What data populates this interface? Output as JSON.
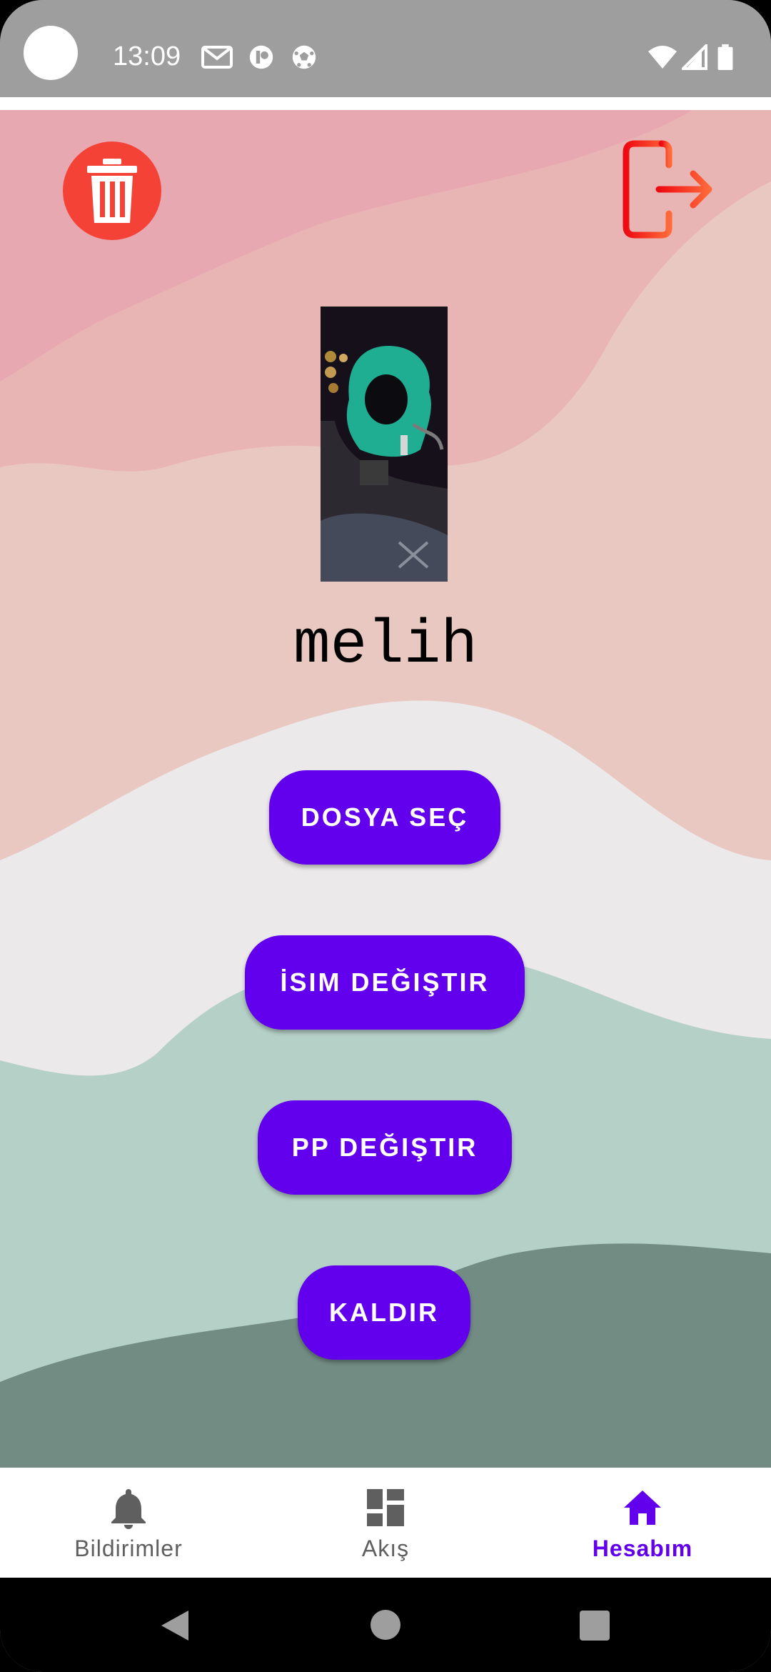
{
  "status_bar": {
    "time": "13:09",
    "left_icons": [
      "gmail-icon",
      "app-notification-icon",
      "soccer-ball-icon"
    ],
    "right_icons": [
      "wifi-icon",
      "signal-icon",
      "battery-icon"
    ]
  },
  "header": {
    "delete_account_icon": "trash-icon",
    "delete_color": "#f44336",
    "logout_icon": "logout-icon",
    "logout_color": "#ff3300"
  },
  "profile": {
    "username": "melih"
  },
  "actions": {
    "choose_file": "DOSYA SEÇ",
    "change_name": "İSIM DEĞIŞTIR",
    "change_pp": "PP DEĞIŞTIR",
    "remove": "KALDIR",
    "button_color": "#6200ee"
  },
  "bottom_nav": {
    "items": [
      {
        "label": "Bildirimler",
        "icon": "bell-icon",
        "active": false
      },
      {
        "label": "Akış",
        "icon": "dashboard-icon",
        "active": false
      },
      {
        "label": "Hesabım",
        "icon": "home-icon",
        "active": true
      }
    ],
    "active_color": "#6200ee"
  },
  "system_nav": {
    "icons": [
      "back-icon",
      "home-circle-icon",
      "recents-icon"
    ]
  }
}
